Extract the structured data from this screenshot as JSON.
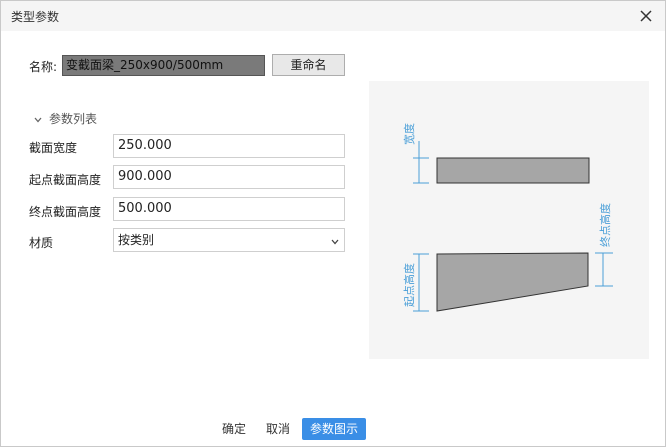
{
  "window": {
    "title": "类型参数"
  },
  "name_row": {
    "label": "名称:",
    "value": "变截面梁_250x900/500mm",
    "rename_label": "重命名"
  },
  "params": {
    "header": "参数列表",
    "rows": [
      {
        "label": "截面宽度",
        "value": "250.000"
      },
      {
        "label": "起点截面高度",
        "value": "900.000"
      },
      {
        "label": "终点截面高度",
        "value": "500.000"
      }
    ],
    "material": {
      "label": "材质",
      "value": "按类别"
    }
  },
  "preview": {
    "width_label": "宽度",
    "start_height_label": "起点高度",
    "end_height_label": "终点高度",
    "colors": {
      "dimension": "#4a9fd8",
      "shape_fill": "#a6a6a6",
      "shape_stroke": "#333333"
    }
  },
  "footer": {
    "ok": "确定",
    "cancel": "取消",
    "diagram": "参数图示"
  },
  "icons": {
    "close": "close-icon",
    "expand": "chevron-down-icon",
    "select": "dropdown-arrow-icon"
  }
}
